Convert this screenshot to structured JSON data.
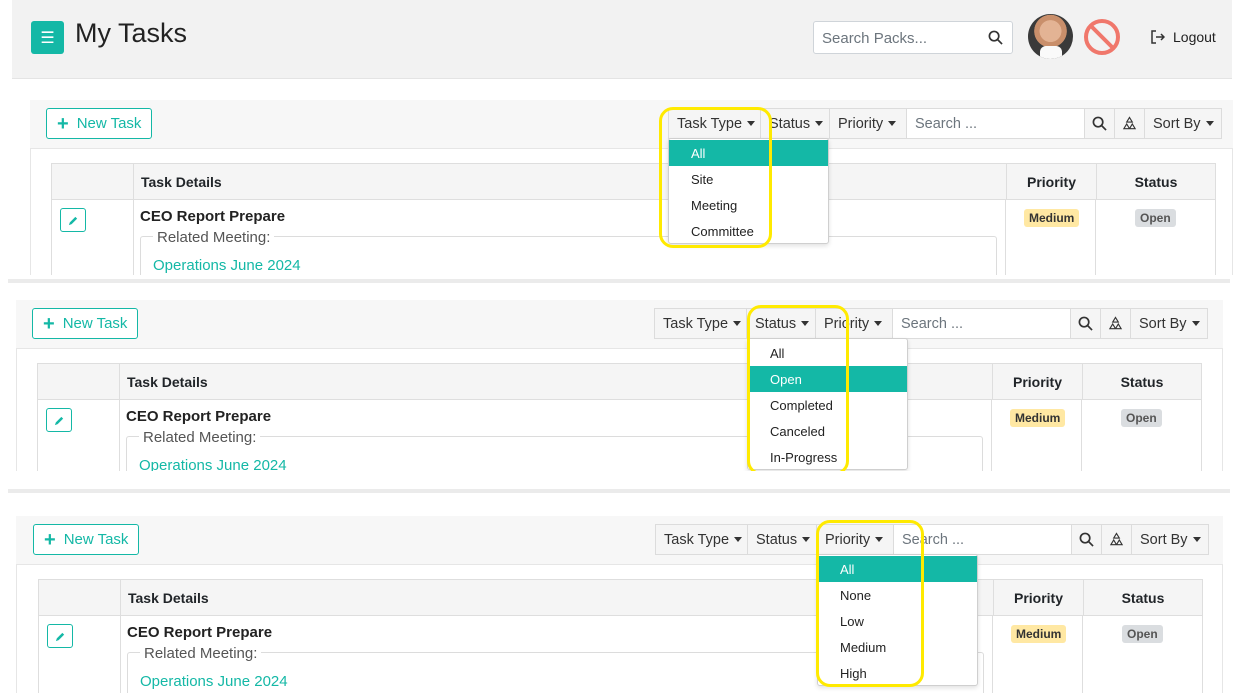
{
  "header": {
    "title": "My Tasks",
    "search_placeholder": "Search Packs...",
    "logout_label": "Logout"
  },
  "toolbar": {
    "new_task_label": "New Task",
    "task_type_label": "Task Type",
    "status_label": "Status",
    "priority_label": "Priority",
    "search_placeholder": "Search ...",
    "sort_label": "Sort By"
  },
  "table": {
    "col_details": "Task Details",
    "col_priority": "Priority",
    "col_status": "Status",
    "task": {
      "title": "CEO Report Prepare",
      "related_label": "Related Meeting:",
      "meeting": "Operations June 2024",
      "priority": "Medium",
      "status": "Open"
    }
  },
  "dropdowns": {
    "task_type": {
      "options": [
        "All",
        "Site",
        "Meeting",
        "Committee"
      ],
      "selected": "All"
    },
    "status": {
      "options": [
        "All",
        "Open",
        "Completed",
        "Canceled",
        "In-Progress"
      ],
      "selected": "Open"
    },
    "priority": {
      "options": [
        "All",
        "None",
        "Low",
        "Medium",
        "High"
      ],
      "selected": "All"
    }
  },
  "colors": {
    "accent": "#14b8a6",
    "highlight": "#ffea00",
    "medium_badge": "#ffe8a3",
    "open_badge": "#dadde0"
  }
}
